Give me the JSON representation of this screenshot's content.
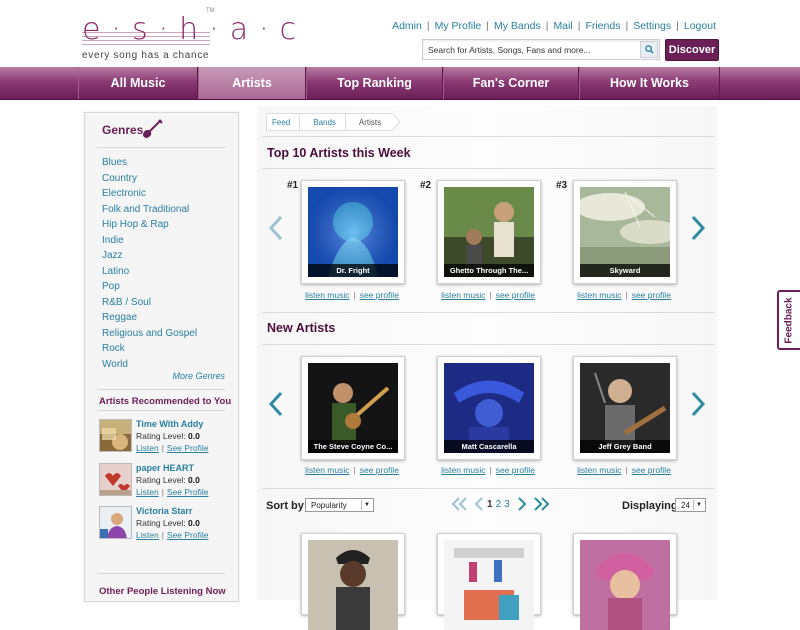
{
  "brand": {
    "name": "e·s·h·a·c",
    "tagline": "every song has a chance",
    "tm": "TM"
  },
  "top_links": [
    "Admin",
    "My Profile",
    "My Bands",
    "Mail",
    "Friends",
    "Settings",
    "Logout"
  ],
  "search": {
    "placeholder": "Search for Artists, Songs, Fans and more...",
    "button": "Discover"
  },
  "nav": {
    "items": [
      "All Music",
      "Artists",
      "Top Ranking",
      "Fan's Corner",
      "How It Works"
    ],
    "active": "Artists"
  },
  "sidebar": {
    "genres_title": "Genres",
    "genres": [
      "Blues",
      "Country",
      "Electronic",
      "Folk and Traditional",
      "Hip Hop & Rap",
      "Indie",
      "Jazz",
      "Latino",
      "Pop",
      "R&B / Soul",
      "Reggae",
      "Religious and Gospel",
      "Rock",
      "World"
    ],
    "more_genres": "More Genres",
    "recommended_title": "Artists Recommended to You",
    "recommended": [
      {
        "name": "Time With Addy",
        "rating_label": "Rating Level:",
        "rating": "0.0",
        "listen": "Listen",
        "see": "See Profile"
      },
      {
        "name": "paper HEART",
        "rating_label": "Rating Level:",
        "rating": "0.0",
        "listen": "Listen",
        "see": "See Profile"
      },
      {
        "name": "Victoria Starr",
        "rating_label": "Rating Level:",
        "rating": "0.0",
        "listen": "Listen",
        "see": "See Profile"
      }
    ],
    "other_title": "Other People Listening Now"
  },
  "breadcrumb": [
    "Feed",
    "Bands",
    "Artists"
  ],
  "top10": {
    "title": "Top 10 Artists this Week",
    "items": [
      {
        "rank": "#1",
        "name": "Dr. Fright",
        "listen": "listen music",
        "see": "see profile"
      },
      {
        "rank": "#2",
        "name": "Ghetto Through The...",
        "listen": "listen music",
        "see": "see profile"
      },
      {
        "rank": "#3",
        "name": "Skyward",
        "listen": "listen music",
        "see": "see profile"
      }
    ]
  },
  "new_artists": {
    "title": "New Artists",
    "items": [
      {
        "name": "The Steve Coyne Co...",
        "listen": "listen music",
        "see": "see profile"
      },
      {
        "name": "Matt Cascarella",
        "listen": "listen music",
        "see": "see profile"
      },
      {
        "name": "Jeff Grey Band",
        "listen": "listen music",
        "see": "see profile"
      }
    ]
  },
  "controls": {
    "sort_label": "Sort by",
    "sort_value": "Popularity",
    "pages": [
      "1",
      "2",
      "3"
    ],
    "displaying_label": "Displaying",
    "displaying_value": "24"
  },
  "feedback": "Feedback",
  "colors": {
    "brand": "#6b1f57",
    "link": "#2a7fa0",
    "arrow": "#2e8ba0"
  }
}
